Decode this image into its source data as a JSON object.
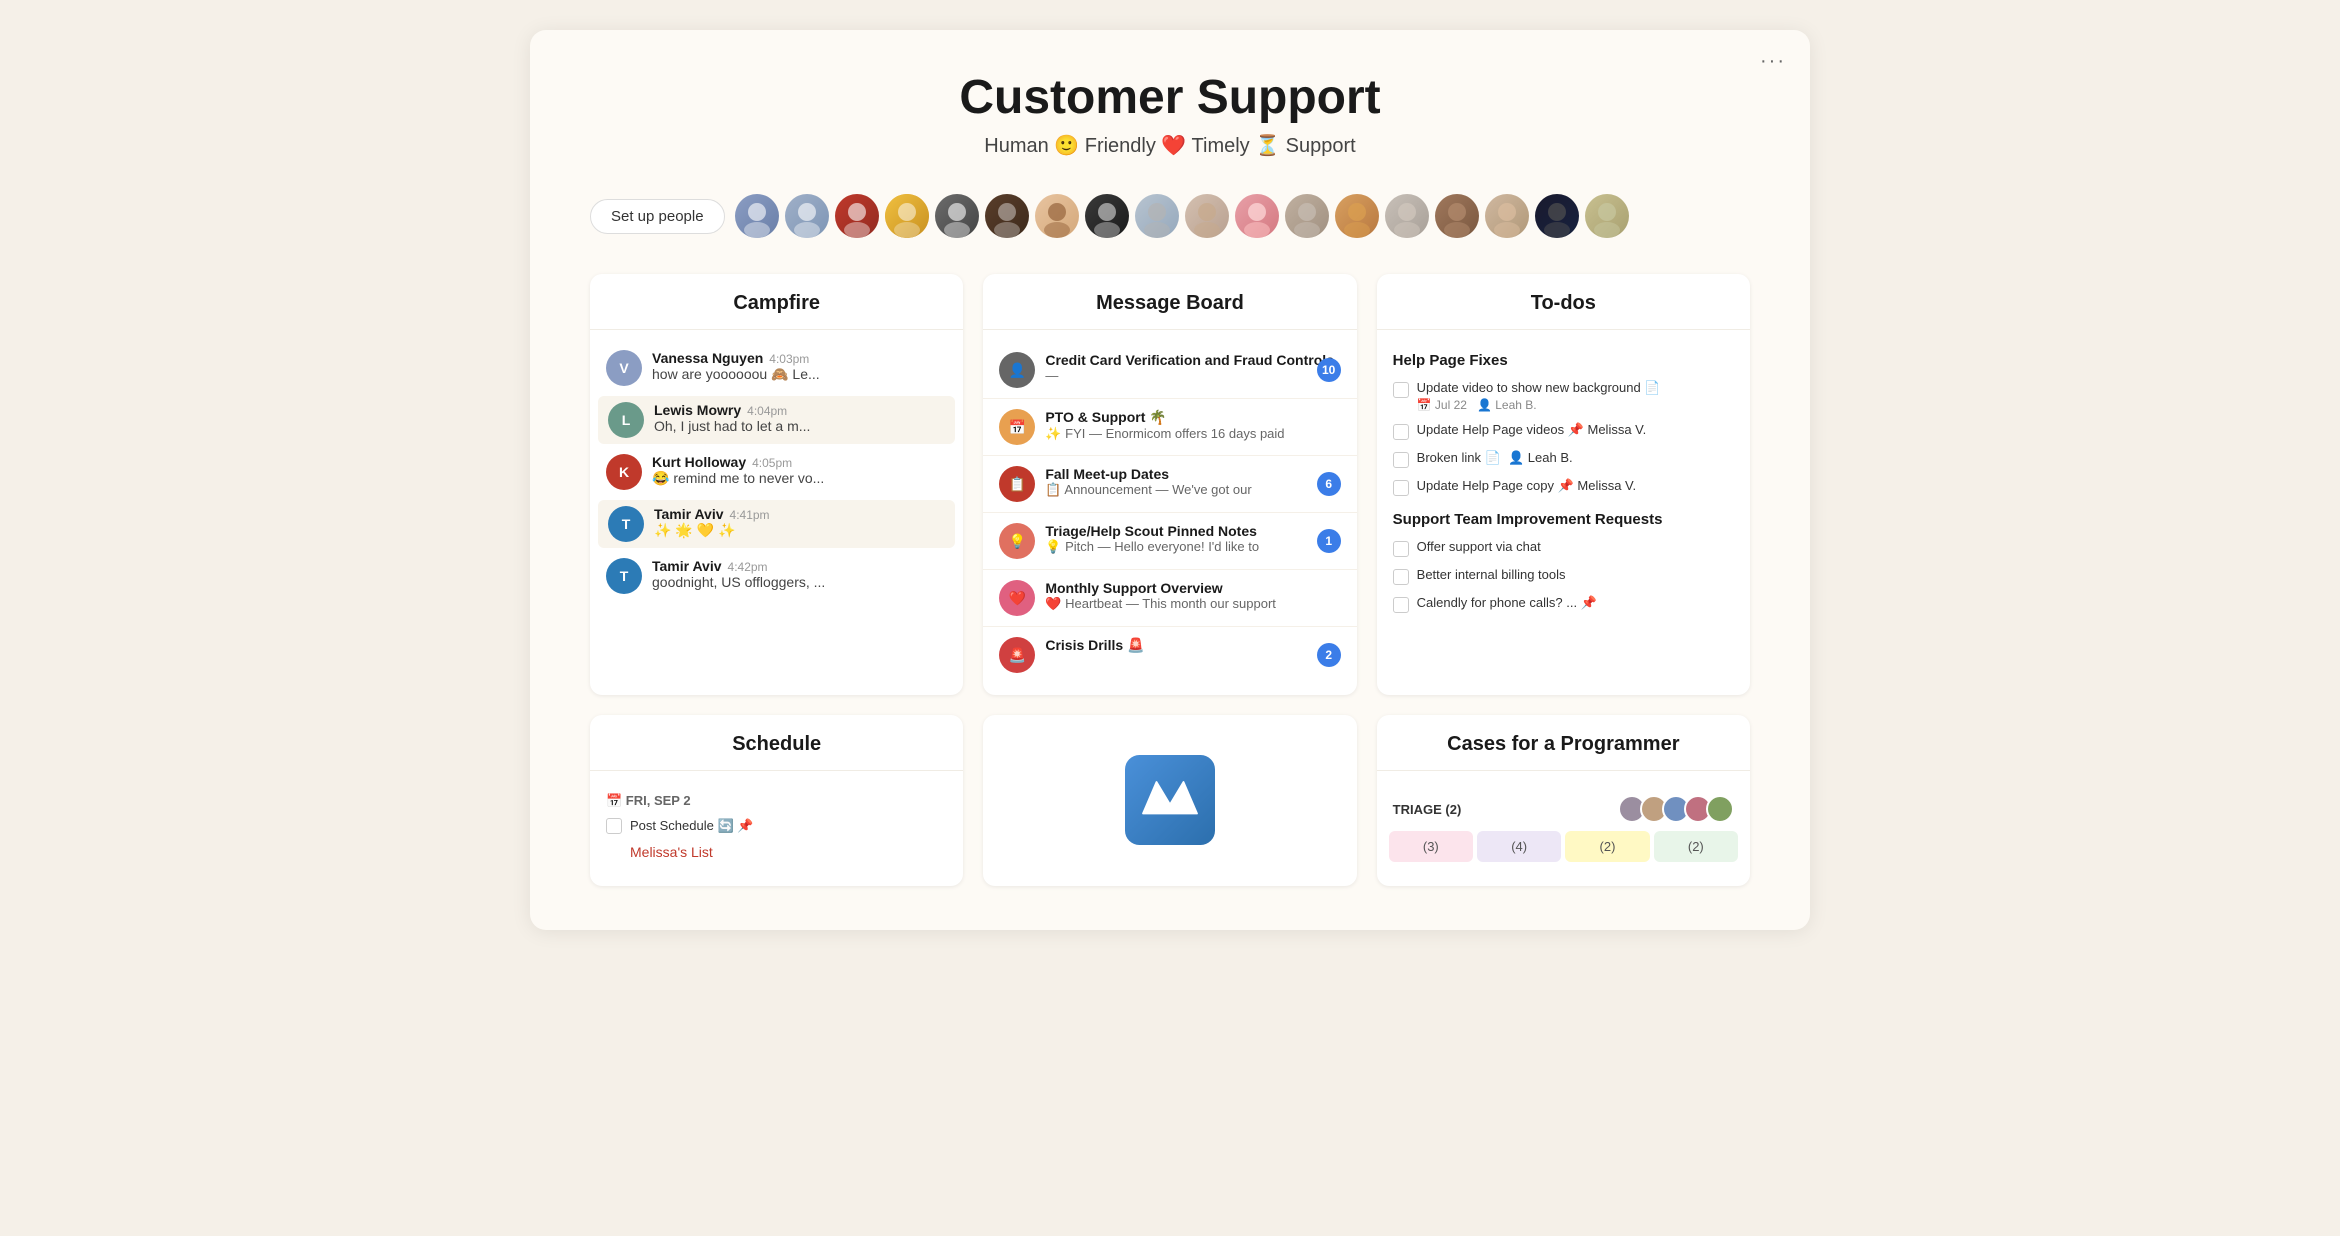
{
  "header": {
    "title": "Customer Support",
    "subtitle": "Human 🙂 Friendly ❤️ Timely ⏳ Support",
    "more_label": "···"
  },
  "people": {
    "setup_btn": "Set up people",
    "avatars": [
      {
        "id": "av1",
        "label": "Person 1",
        "emoji": ""
      },
      {
        "id": "av2",
        "label": "Person 2",
        "emoji": ""
      },
      {
        "id": "av3",
        "label": "Person 3",
        "emoji": ""
      },
      {
        "id": "av4",
        "label": "Person 4",
        "emoji": ""
      },
      {
        "id": "av5",
        "label": "Person 5",
        "emoji": ""
      },
      {
        "id": "av6",
        "label": "Person 6",
        "emoji": ""
      },
      {
        "id": "av7",
        "label": "Person 7",
        "emoji": ""
      },
      {
        "id": "av8",
        "label": "Person 8",
        "emoji": ""
      },
      {
        "id": "av9",
        "label": "Person 9",
        "emoji": ""
      },
      {
        "id": "av10",
        "label": "Person 10",
        "emoji": ""
      },
      {
        "id": "av11",
        "label": "Person 11",
        "emoji": ""
      },
      {
        "id": "av12",
        "label": "Person 12",
        "emoji": ""
      },
      {
        "id": "av13",
        "label": "Person 13",
        "emoji": ""
      },
      {
        "id": "av14",
        "label": "Person 14",
        "emoji": ""
      },
      {
        "id": "av15",
        "label": "Person 15",
        "emoji": ""
      },
      {
        "id": "av16",
        "label": "Person 16",
        "emoji": ""
      },
      {
        "id": "av17",
        "label": "Person 17",
        "emoji": ""
      },
      {
        "id": "av18",
        "label": "Person 18",
        "emoji": ""
      }
    ]
  },
  "campfire": {
    "title": "Campfire",
    "messages": [
      {
        "name": "Vanessa Nguyen",
        "time": "4:03pm",
        "text": "how are yoooooou 🙈 Le...",
        "color": "#8B9DC3",
        "highlighted": false
      },
      {
        "name": "Lewis Mowry",
        "time": "4:04pm",
        "text": "Oh, I just had to let a m...",
        "color": "#6a9a8a",
        "highlighted": true
      },
      {
        "name": "Kurt Holloway",
        "time": "4:05pm",
        "text": "😂 remind me to never vo...",
        "color": "#c0392b",
        "highlighted": false
      },
      {
        "name": "Tamir Aviv",
        "time": "4:41pm",
        "text": "✨🌟💛✨",
        "color": "#2c7bb6",
        "highlighted": true
      },
      {
        "name": "Tamir Aviv",
        "time": "4:42pm",
        "text": "goodnight, US offloggers, ...",
        "color": "#2c7bb6",
        "highlighted": false
      }
    ]
  },
  "message_board": {
    "title": "Message Board",
    "items": [
      {
        "title": "Credit Card Verification and Fraud Controls",
        "sub": "— ",
        "badge": "10",
        "avatar_color": "#555"
      },
      {
        "title": "PTO & Support 🌴",
        "sub": "✨ FYI — Enormicom offers 16 days paid",
        "badge": null,
        "avatar_color": "#e8a050"
      },
      {
        "title": "Fall Meet-up Dates",
        "sub": "📋 Announcement — We've got our",
        "badge": "6",
        "avatar_color": "#c0392b"
      },
      {
        "title": "Triage/Help Scout Pinned Notes",
        "sub": "💡 Pitch — Hello everyone! I'd like to",
        "badge": "1",
        "avatar_color": "#e07060"
      },
      {
        "title": "Monthly Support Overview",
        "sub": "❤️ Heartbeat — This month our support",
        "badge": null,
        "avatar_color": "#e06080"
      },
      {
        "title": "Crisis Drills 🚨",
        "sub": "",
        "badge": "2",
        "avatar_color": "#d04040"
      }
    ]
  },
  "todos": {
    "title": "To-dos",
    "sections": [
      {
        "title": "Help Page Fixes",
        "items": [
          {
            "text": "Update video to show new background 📄",
            "meta": "📅 Jul 22  👤 Leah B.",
            "done": false
          },
          {
            "text": "Update Help Page videos 📌 Melissa V.",
            "meta": "",
            "done": false
          },
          {
            "text": "Broken link 📄  👤 Leah B.",
            "meta": "",
            "done": false
          },
          {
            "text": "Update Help Page copy 📌 Melissa V.",
            "meta": "",
            "done": false
          }
        ]
      },
      {
        "title": "Support Team Improvement Requests",
        "items": [
          {
            "text": "Offer support via chat",
            "meta": "",
            "done": false
          },
          {
            "text": "Better internal billing tools",
            "meta": "",
            "done": false
          },
          {
            "text": "Calendly for phone calls? ... 📌",
            "meta": "",
            "done": false
          }
        ]
      }
    ]
  },
  "schedule": {
    "title": "Schedule",
    "date": "📅 FRI, SEP 2",
    "items": [
      {
        "text": "Post Schedule 🔄 📌",
        "link": false
      },
      {
        "text": "Melissa's List",
        "link": true
      }
    ]
  },
  "cases": {
    "title": "Cases for a Programmer",
    "triage_label": "TRIAGE (2)",
    "columns": [
      {
        "label": "(3)",
        "color": "pink"
      },
      {
        "label": "(4)",
        "color": "purple"
      },
      {
        "label": "(2)",
        "color": "yellow"
      },
      {
        "label": "(2)",
        "color": "green"
      }
    ]
  }
}
